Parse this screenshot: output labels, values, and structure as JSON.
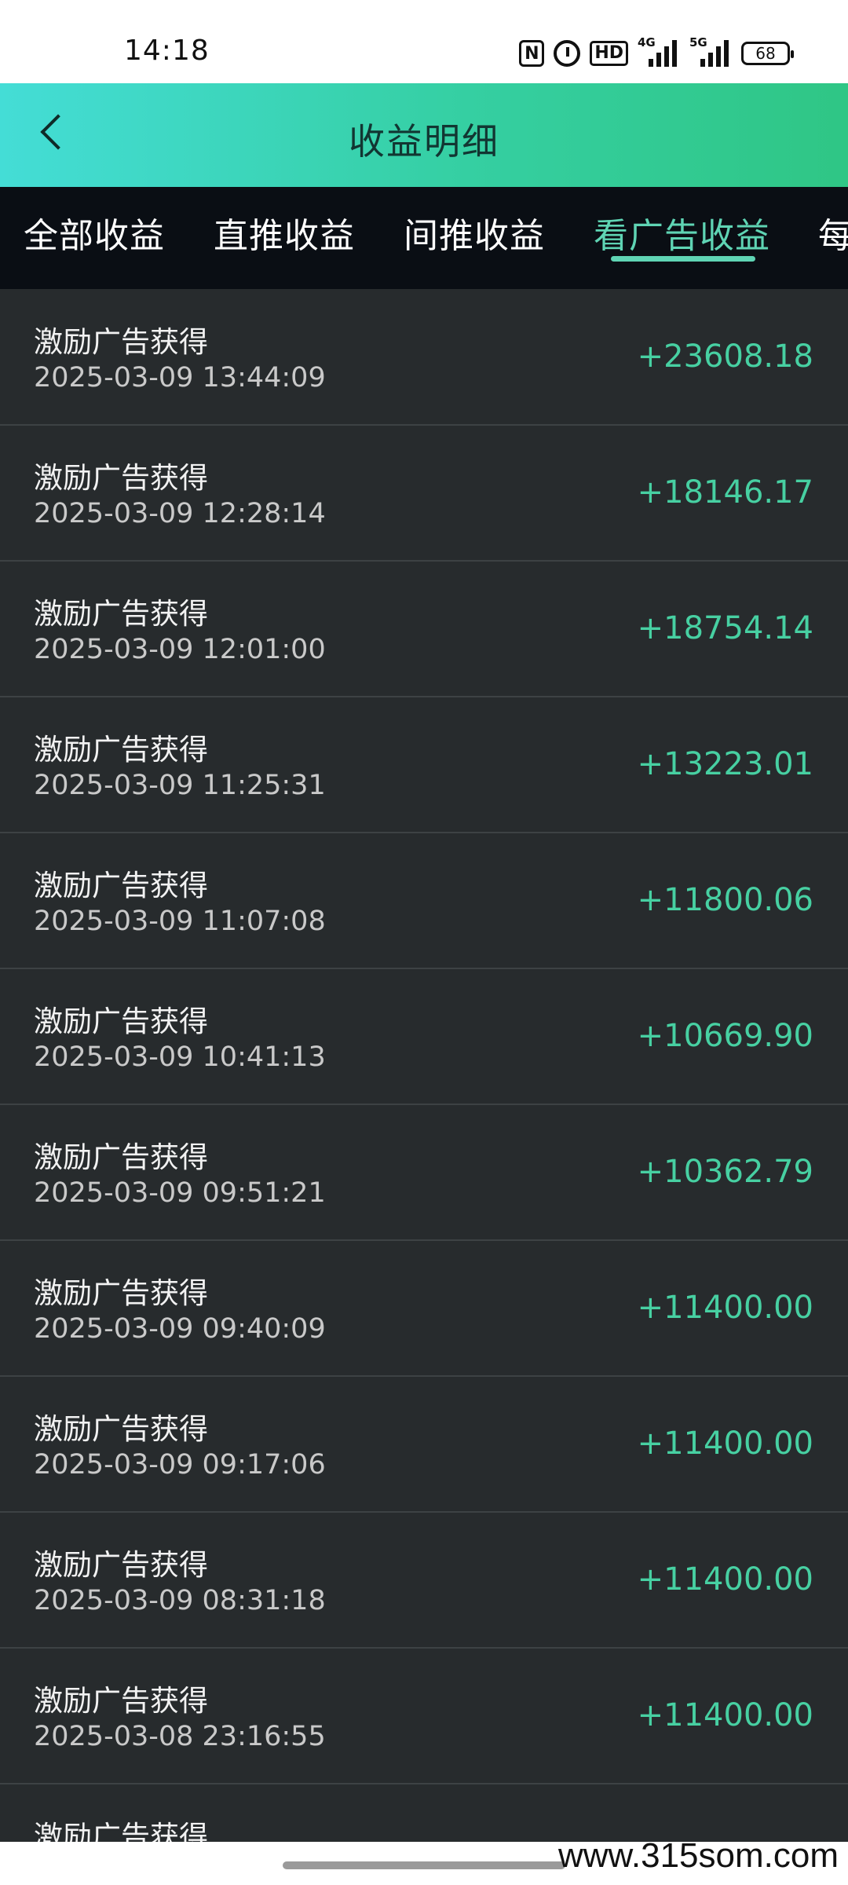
{
  "status_bar": {
    "time": "14:18",
    "nfc_label": "N",
    "hd_label": "HD",
    "signal_1_label": "4G",
    "signal_2_label": "5G",
    "battery": "68"
  },
  "header": {
    "title": "收益明细"
  },
  "tabs": [
    {
      "label": "全部收益"
    },
    {
      "label": "直推收益"
    },
    {
      "label": "间推收益"
    },
    {
      "label": "看广告收益"
    },
    {
      "label": "每"
    }
  ],
  "active_tab": 3,
  "records": [
    {
      "title": "激励广告获得",
      "time": "2025-03-09 13:44:09",
      "amount": "+23608.18"
    },
    {
      "title": "激励广告获得",
      "time": "2025-03-09 12:28:14",
      "amount": "+18146.17"
    },
    {
      "title": "激励广告获得",
      "time": "2025-03-09 12:01:00",
      "amount": "+18754.14"
    },
    {
      "title": "激励广告获得",
      "time": "2025-03-09 11:25:31",
      "amount": "+13223.01"
    },
    {
      "title": "激励广告获得",
      "time": "2025-03-09 11:07:08",
      "amount": "+11800.06"
    },
    {
      "title": "激励广告获得",
      "time": "2025-03-09 10:41:13",
      "amount": "+10669.90"
    },
    {
      "title": "激励广告获得",
      "time": "2025-03-09 09:51:21",
      "amount": "+10362.79"
    },
    {
      "title": "激励广告获得",
      "time": "2025-03-09 09:40:09",
      "amount": "+11400.00"
    },
    {
      "title": "激励广告获得",
      "time": "2025-03-09 09:17:06",
      "amount": "+11400.00"
    },
    {
      "title": "激励广告获得",
      "time": "2025-03-09 08:31:18",
      "amount": "+11400.00"
    },
    {
      "title": "激励广告获得",
      "time": "2025-03-08 23:16:55",
      "amount": "+11400.00"
    }
  ],
  "partial_record_title": "激励广告获得",
  "watermark": "www.315som.com",
  "colors": {
    "accent": "#47d0a2",
    "header_start": "#44ddd6",
    "header_end": "#2fc685",
    "background": "#272b2d"
  }
}
